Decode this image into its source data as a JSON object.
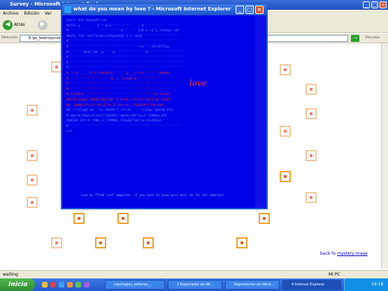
{
  "background_window": {
    "title": "Survey - Microsoft Internet Explorer",
    "menu": [
      "Archivo",
      "Edición",
      "Ver"
    ],
    "back_label": "Atrás",
    "address_label": "Dirección",
    "address_value": "E:\\pc_teatro\\survey.htm",
    "links_label": "Vínculos",
    "back_link_prefix": "back to",
    "back_link_text": "mystery mage",
    "status_text": "waiting",
    "status_zone": "Mi PC"
  },
  "popup": {
    "title": "what do you mean by love ? - Microsoft Internet Explorer",
    "love_text": "love",
    "footer_note": "love by TTG10    (not complete, if you want to know more mail me for her address)",
    "ascii_lines": [
      "begin 644 Happy64.one",
      "M455E`@`       `2`^`$L@`''''''''''   '`8`'''''''''`'''''''",
      "M''''''''''''   ''''''''''''$^'`  ''`X3M'G-(3'3,TX5U$4:'N8'",
      "M84TE:T5D^!$52^R+&8+C%95@%$VSE,5'<'=$EW'''''''''''''''''''",
      "M'''''''''''''''''''''''''''''''''''''''''''''''''''''''''",
      "M'''''''''''''''''''''''''''''''''''''E4''',%G\\GP7TC@",
      "M''''' ''8%$1'AD'`@''`'!@' ''''''''''' ''8'''''''''''''''''''",
      "M''''''''''''''''''''' '''''''''''''''''''''''''''''''''''''",
      "M''''''''''''''''''''''''''''''''''''''''''''''''''''''''''''",
      "M'''''''''''''''''''''''''''''''''''''''''''''''''''''''''''",
      "M__[_9______D_X]_U1%4D\\&'''''__Q___[1]/%''''''''#%H@M",
      "M'''''''''''''''''''''(4__\\__U1%4D\\&'''''''''''''''''''''''",
      "M''''''''''''''''''''''''''''''''''''''''''''''''''''''''''",
      "M''''''''''''''''''''''''''''''''''''''''''''''''''''''''''",
      "M_U1%4D\\&''''''''''''''''''''''''''''''''''''(U_U1%4D\\",
      "MOEFDCI@@@Z`XR85O+0WCZ&8^'O,W>HS>!'K<(OY'A%2U-@2.OIMZ%",
      "M6:.QHKN=5*U/O7!8E\\ZJ!8(7C+GB+*Q\\-,O&TH)M!T!FW.KVK--",
      "MB'!7*$T@@#'H&''`E>:P8UVP!T.>P!+#''''''J/OA@''6WJ2W:RTS",
      "M;3@S*W(YB@O=A11E52CSAD2MX(^8@9O<!KR*($>X'7H9WK@,AEF",
      "M$HCD4.1PY!P'!P#K.CC?2PMR8L.U5X@FB^GHF!@+\\6>#DXK2-'",
      "M''''''''''''''''''''''''''''''''''''''''''''''''''''''''''",
      "end"
    ]
  },
  "taskbar": {
    "start_label": "Inicio",
    "tasks": [
      "topologias_editores_...",
      "3 Explorador de Wi...",
      "Reproductor de Wind...",
      "4 Internet Explorer"
    ],
    "clock": "19:18"
  }
}
